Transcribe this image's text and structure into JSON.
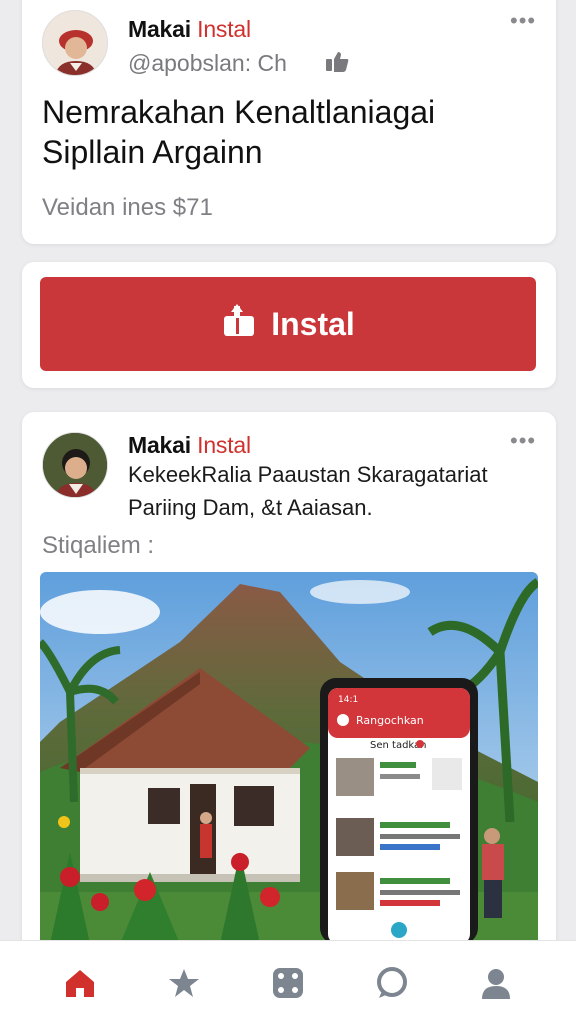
{
  "post1": {
    "author_name": "Makai",
    "author_action": "Instal",
    "handle": "@apobslan: Ch",
    "title_line1": "Nemrakahan Kenaltlaniagai",
    "title_line2": "Sipllain Argainn",
    "meta": "Veidan ines $71"
  },
  "install": {
    "label": "Instal"
  },
  "post2": {
    "author_name": "Makai",
    "author_action": "Instal",
    "text_line1": "KekeekRalia Paaustan Skaragatariat",
    "text_line2": "Pariing Dam, &t Aaiasan.",
    "meta": "Stiqaliem :",
    "phone": {
      "status_time": "14:1",
      "app_title": "Rangochkan",
      "section_label": "Sen tadkan"
    }
  },
  "colors": {
    "accent": "#d0312d",
    "button": "#c9373a",
    "nav_active": "#d0312d",
    "nav_inactive": "#7d8590"
  },
  "nav": {
    "items": [
      {
        "icon": "home-icon",
        "active": true
      },
      {
        "icon": "star-icon",
        "active": false
      },
      {
        "icon": "dice-icon",
        "active": false
      },
      {
        "icon": "chat-icon",
        "active": false
      },
      {
        "icon": "profile-icon",
        "active": false
      }
    ]
  }
}
